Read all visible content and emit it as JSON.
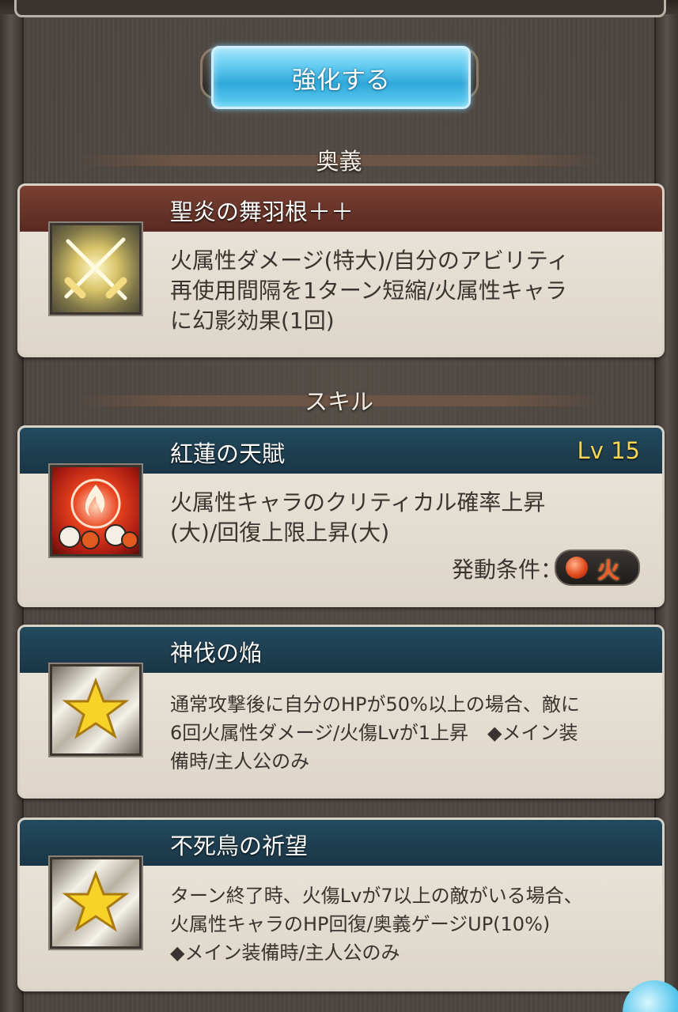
{
  "enhance_button": {
    "label": "強化する"
  },
  "ougi_section": {
    "header": "奥義",
    "card": {
      "title": "聖炎の舞羽根＋＋",
      "description": "火属性ダメージ(特大)/自分のアビリティ\n再使用間隔を1ターン短縮/火属性キャラ\nに幻影効果(1回)",
      "icon": "crossed-swords-icon"
    }
  },
  "skill_section": {
    "header": "スキル",
    "skills": [
      {
        "title": "紅蓮の天賦",
        "level": "Lv 15",
        "description": "火属性キャラのクリティカル確率上昇\n(大)/回復上限上昇(大)",
        "condition_label": "発動条件：",
        "condition_value": "火",
        "icon": "fire-emblem-icon"
      },
      {
        "title": "神伐の焔",
        "description": "通常攻撃後に自分のHPが50%以上の場合、敵に\n6回火属性ダメージ/火傷Lvが1上昇　◆メイン装\n備時/主人公のみ",
        "icon": "star-icon"
      },
      {
        "title": "不死鳥の祈望",
        "description": "ターン終了時、火傷Lvが7以上の敵がいる場合、\n火属性キャラのHP回復/奥義ゲージUP(10%)\n◆メイン装備時/主人公のみ",
        "icon": "star-icon"
      }
    ]
  },
  "colors": {
    "ougi_header": "#6a3428",
    "skill_header": "#1f4154",
    "level_text": "#f7d654",
    "fire_text": "#f25a2a",
    "button": "#4cbfeb"
  }
}
